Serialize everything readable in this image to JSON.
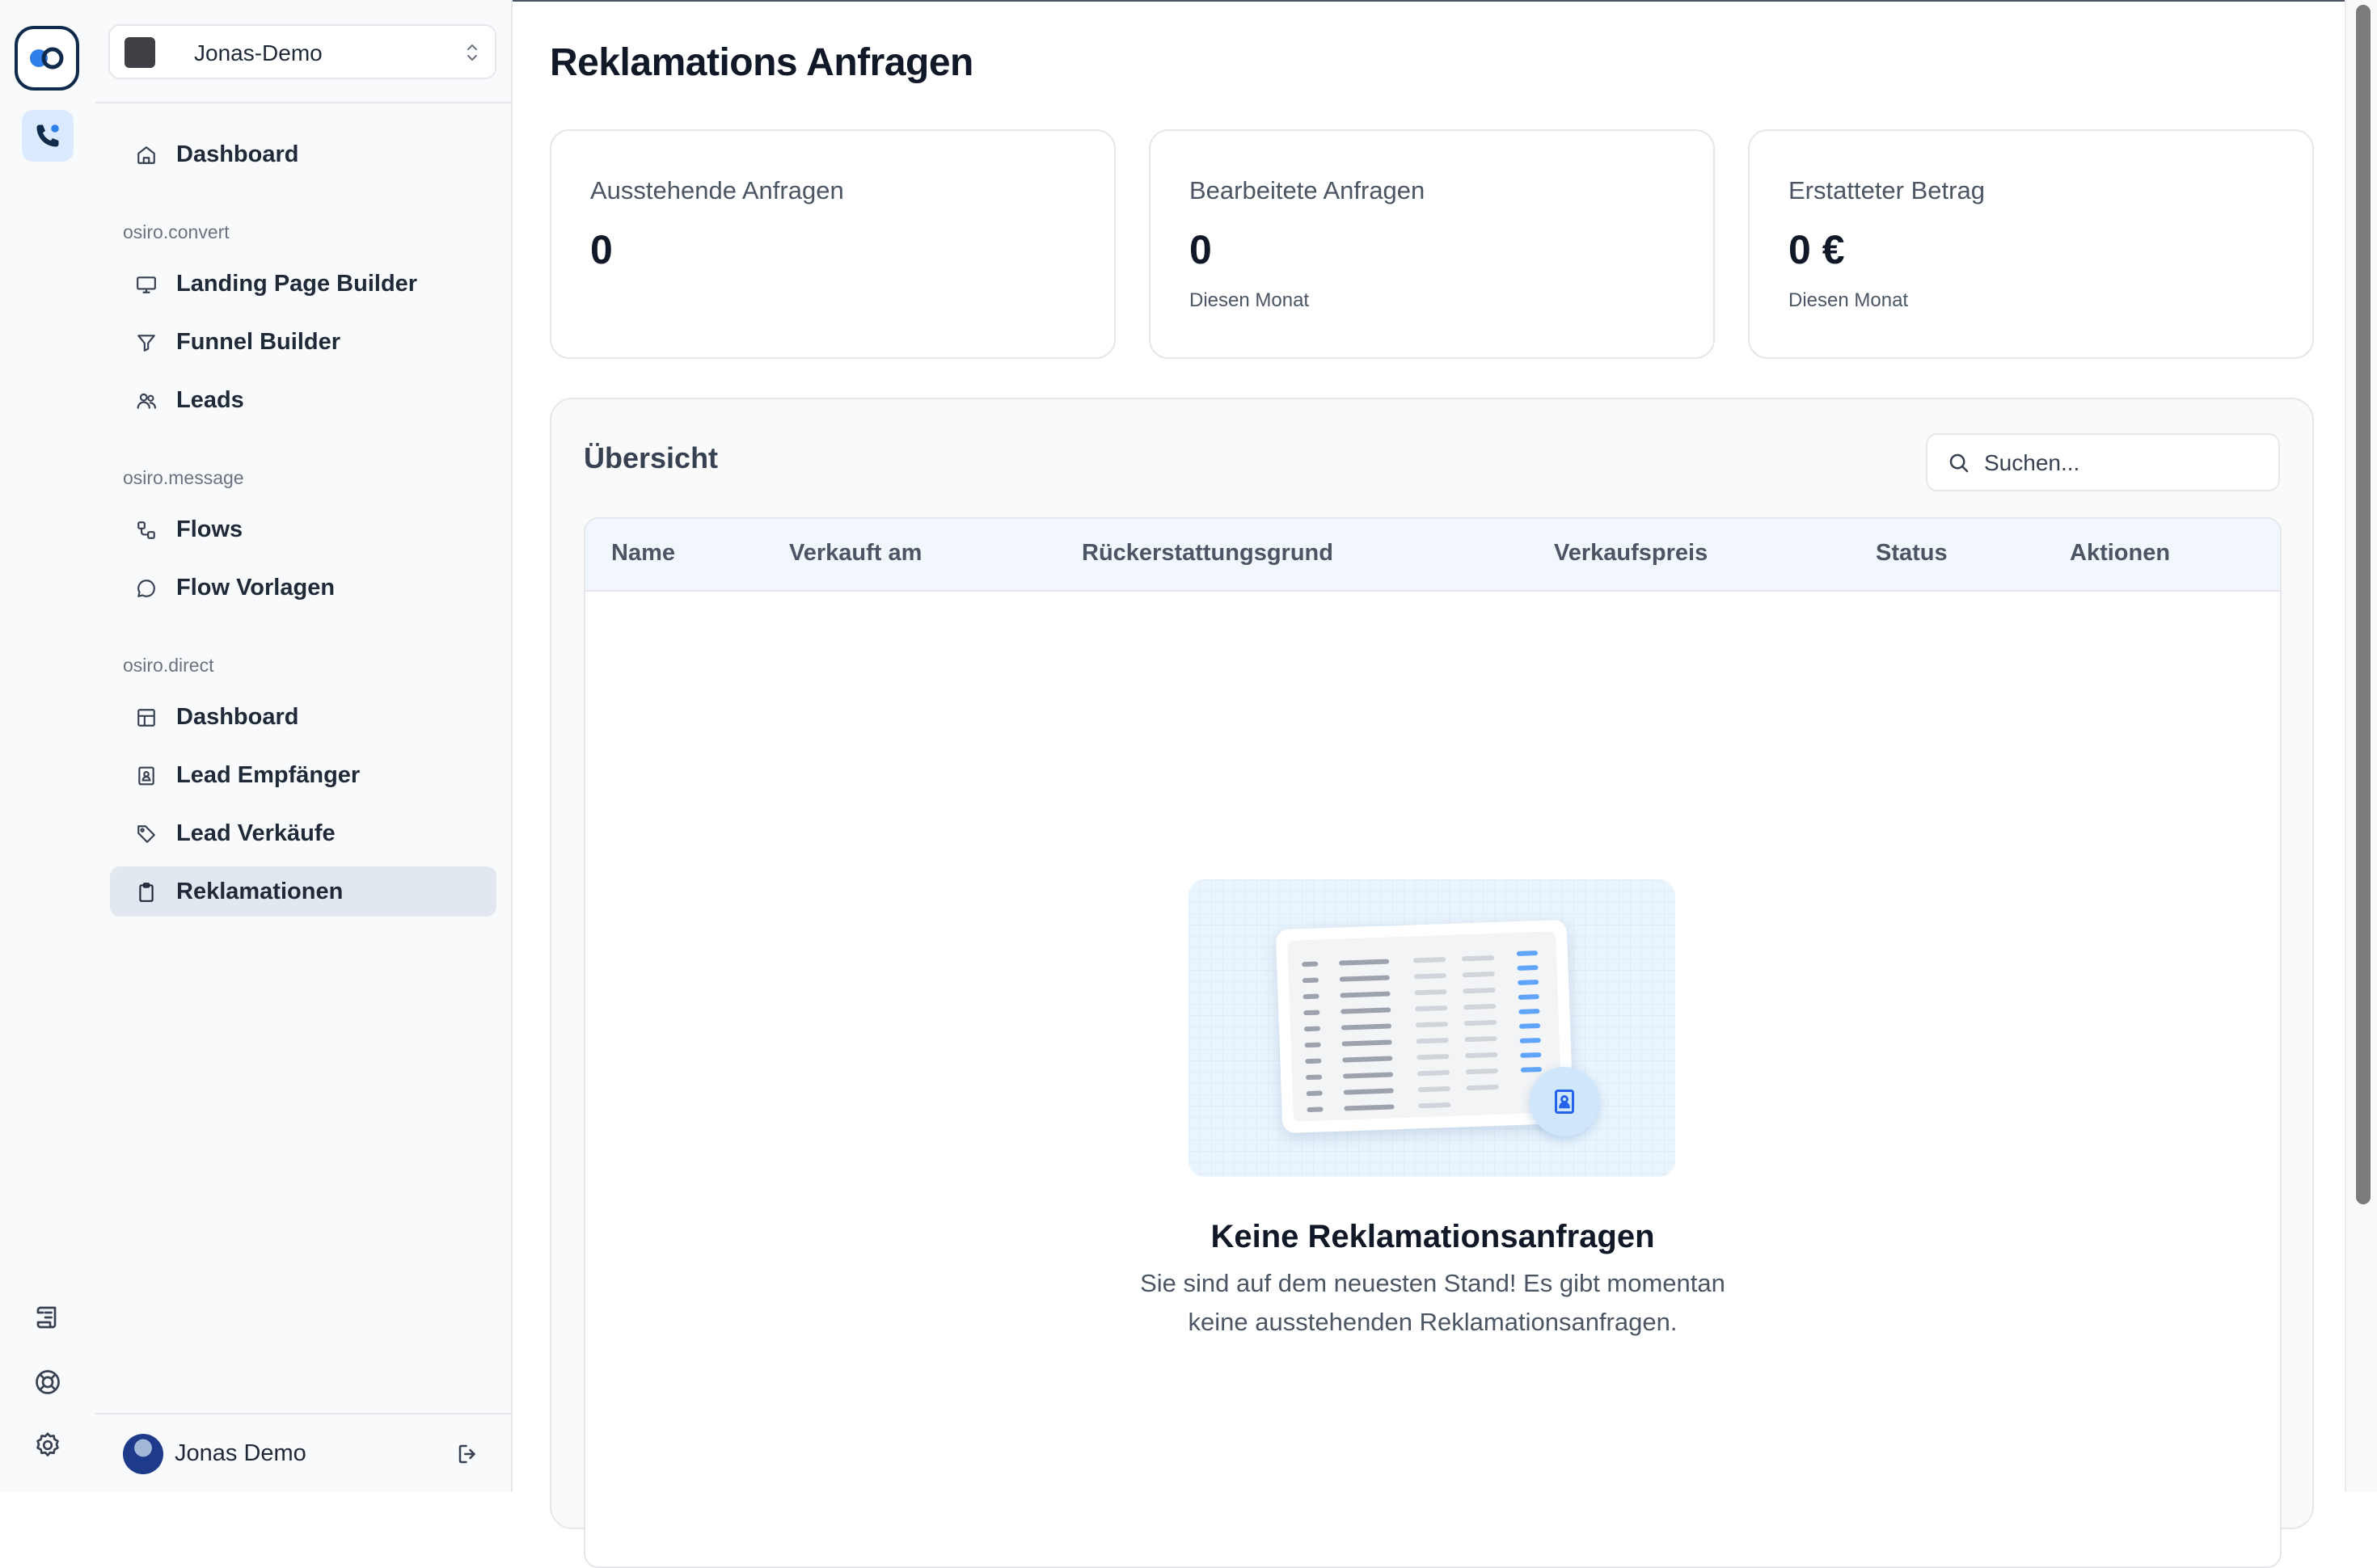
{
  "workspace": {
    "name": "Jonas-Demo"
  },
  "sidebar": {
    "top_item": {
      "label": "Dashboard",
      "icon": "home-icon"
    },
    "sections": [
      {
        "label": "osiro.convert",
        "items": [
          {
            "label": "Landing Page Builder",
            "icon": "monitor-icon"
          },
          {
            "label": "Funnel Builder",
            "icon": "filter-icon"
          },
          {
            "label": "Leads",
            "icon": "users-icon"
          }
        ]
      },
      {
        "label": "osiro.message",
        "items": [
          {
            "label": "Flows",
            "icon": "flow-icon"
          },
          {
            "label": "Flow Vorlagen",
            "icon": "chat-bubble-icon"
          }
        ]
      },
      {
        "label": "osiro.direct",
        "items": [
          {
            "label": "Dashboard",
            "icon": "layout-icon"
          },
          {
            "label": "Lead Empfänger",
            "icon": "contact-book-icon"
          },
          {
            "label": "Lead Verkäufe",
            "icon": "tag-icon"
          },
          {
            "label": "Reklamationen",
            "icon": "clipboard-icon",
            "active": true
          }
        ]
      }
    ],
    "user": {
      "name": "Jonas Demo"
    }
  },
  "page": {
    "title": "Reklamations Anfragen"
  },
  "stats": [
    {
      "title": "Ausstehende Anfragen",
      "value": "0",
      "sub": ""
    },
    {
      "title": "Bearbeitete Anfragen",
      "value": "0",
      "sub": "Diesen Monat"
    },
    {
      "title": "Erstatteter Betrag",
      "value": "0 €",
      "sub": "Diesen Monat"
    }
  ],
  "overview": {
    "title": "Übersicht",
    "search_placeholder": "Suchen...",
    "columns": [
      "Name",
      "Verkauft am",
      "Rückerstattungsgrund",
      "Verkaufspreis",
      "Status",
      "Aktionen"
    ],
    "empty_title": "Keine Reklamationsanfragen",
    "empty_text_line1": "Sie sind auf dem neuesten Stand! Es gibt momentan",
    "empty_text_line2": "keine ausstehenden Reklamationsanfragen."
  },
  "colors": {
    "accent": "#2563eb",
    "active_bg": "#e2e8f0",
    "brand_dark": "#0f2a4a"
  }
}
